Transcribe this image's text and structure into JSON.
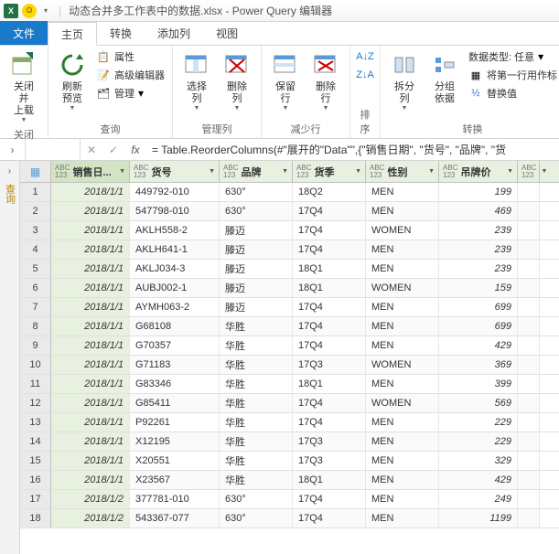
{
  "titlebar": {
    "excel_label": "X",
    "title": "动态合并多工作表中的数据.xlsx - Power Query 编辑器"
  },
  "tabs": {
    "file": "文件",
    "home": "主页",
    "transform": "转换",
    "addcol": "添加列",
    "view": "视图"
  },
  "ribbon": {
    "close_group": {
      "close_apply": "关闭并\n上载",
      "label": "关闭"
    },
    "query_group": {
      "refresh": "刷新\n预览",
      "properties": "属性",
      "adv_editor": "高级编辑器",
      "manage": "管理",
      "label": "查询"
    },
    "manage_cols": {
      "choose": "选择\n列",
      "remove": "删除\n列",
      "label": "管理列"
    },
    "reduce_rows": {
      "keep": "保留\n行",
      "remove": "删除\n行",
      "label": "减少行"
    },
    "sort": {
      "label": "排序"
    },
    "transform": {
      "split": "拆分\n列",
      "group": "分组\n依据",
      "datatype": "数据类型: 任意",
      "first_row": "将第一行用作标",
      "replace": "替换值",
      "label": "转换"
    }
  },
  "side": {
    "queries": "查询"
  },
  "formula": "= Table.ReorderColumns(#\"展开的\"Data\"\",{\"销售日期\", \"货号\", \"品牌\", \"货",
  "columns": [
    {
      "type": "ABC\n123",
      "label": "销售日..."
    },
    {
      "type": "ABC\n123",
      "label": "货号"
    },
    {
      "type": "ABC\n123",
      "label": "品牌"
    },
    {
      "type": "ABC\n123",
      "label": "货季"
    },
    {
      "type": "ABC\n123",
      "label": "性别"
    },
    {
      "type": "ABC\n123",
      "label": "吊牌价"
    },
    {
      "type": "ABC\n123",
      "label": ""
    }
  ],
  "rows": [
    {
      "n": 1,
      "date": "2018/1/1",
      "code": "449792-010",
      "brand": "630°",
      "season": "18Q2",
      "gender": "MEN",
      "price": 199
    },
    {
      "n": 2,
      "date": "2018/1/1",
      "code": "547798-010",
      "brand": "630°",
      "season": "17Q4",
      "gender": "MEN",
      "price": 469
    },
    {
      "n": 3,
      "date": "2018/1/1",
      "code": "AKLH558-2",
      "brand": "滕迈",
      "season": "17Q4",
      "gender": "WOMEN",
      "price": 239
    },
    {
      "n": 4,
      "date": "2018/1/1",
      "code": "AKLH641-1",
      "brand": "滕迈",
      "season": "17Q4",
      "gender": "MEN",
      "price": 239
    },
    {
      "n": 5,
      "date": "2018/1/1",
      "code": "AKLJ034-3",
      "brand": "滕迈",
      "season": "18Q1",
      "gender": "MEN",
      "price": 239
    },
    {
      "n": 6,
      "date": "2018/1/1",
      "code": "AUBJ002-1",
      "brand": "滕迈",
      "season": "18Q1",
      "gender": "WOMEN",
      "price": 159
    },
    {
      "n": 7,
      "date": "2018/1/1",
      "code": "AYMH063-2",
      "brand": "滕迈",
      "season": "17Q4",
      "gender": "MEN",
      "price": 699
    },
    {
      "n": 8,
      "date": "2018/1/1",
      "code": "G68108",
      "brand": "华胜",
      "season": "17Q4",
      "gender": "MEN",
      "price": 699
    },
    {
      "n": 9,
      "date": "2018/1/1",
      "code": "G70357",
      "brand": "华胜",
      "season": "17Q4",
      "gender": "MEN",
      "price": 429
    },
    {
      "n": 10,
      "date": "2018/1/1",
      "code": "G71183",
      "brand": "华胜",
      "season": "17Q3",
      "gender": "WOMEN",
      "price": 369
    },
    {
      "n": 11,
      "date": "2018/1/1",
      "code": "G83346",
      "brand": "华胜",
      "season": "18Q1",
      "gender": "MEN",
      "price": 399
    },
    {
      "n": 12,
      "date": "2018/1/1",
      "code": "G85411",
      "brand": "华胜",
      "season": "17Q4",
      "gender": "WOMEN",
      "price": 569
    },
    {
      "n": 13,
      "date": "2018/1/1",
      "code": "P92261",
      "brand": "华胜",
      "season": "17Q4",
      "gender": "MEN",
      "price": 229
    },
    {
      "n": 14,
      "date": "2018/1/1",
      "code": "X12195",
      "brand": "华胜",
      "season": "17Q3",
      "gender": "MEN",
      "price": 229
    },
    {
      "n": 15,
      "date": "2018/1/1",
      "code": "X20551",
      "brand": "华胜",
      "season": "17Q3",
      "gender": "MEN",
      "price": 329
    },
    {
      "n": 16,
      "date": "2018/1/1",
      "code": "X23567",
      "brand": "华胜",
      "season": "18Q1",
      "gender": "MEN",
      "price": 429
    },
    {
      "n": 17,
      "date": "2018/1/2",
      "code": "377781-010",
      "brand": "630°",
      "season": "17Q4",
      "gender": "MEN",
      "price": 249
    },
    {
      "n": 18,
      "date": "2018/1/2",
      "code": "543367-077",
      "brand": "630°",
      "season": "17Q4",
      "gender": "MEN",
      "price": 1199
    }
  ]
}
